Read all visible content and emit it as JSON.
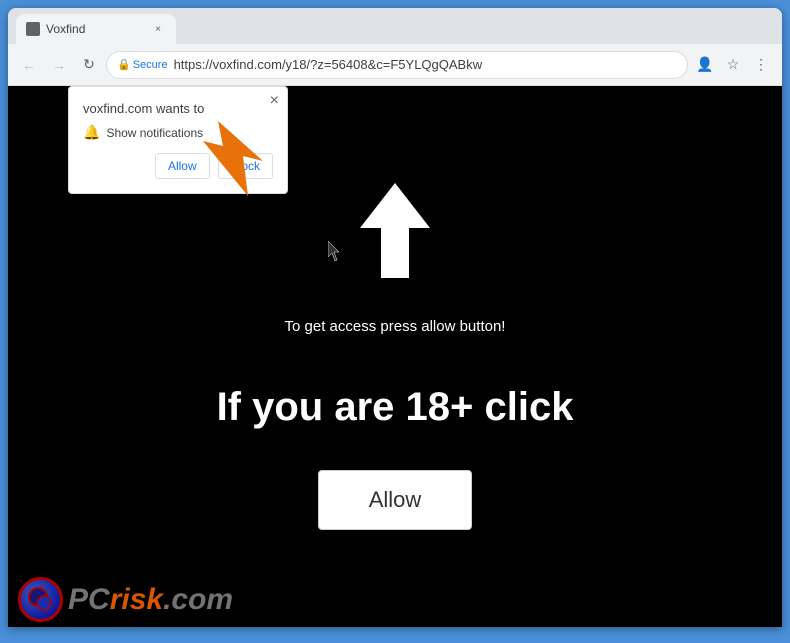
{
  "browser": {
    "tab": {
      "title": "Voxfind",
      "favicon": "V"
    },
    "address": {
      "secure_label": "Secure",
      "url": "https://voxfind.com/y18/?z=56408&c=F5YLQgQABkw"
    },
    "nav": {
      "back": "←",
      "forward": "→",
      "refresh": "↻"
    },
    "toolbar": {
      "bookmark_icon": "☆",
      "menu_icon": "⋮",
      "profile_icon": "👤"
    }
  },
  "notification_popup": {
    "title": "voxfind.com wants to",
    "close_label": "×",
    "notification_item": "Show notifications",
    "allow_btn": "Allow",
    "block_btn": "Block"
  },
  "page": {
    "sub_text": "To get access press allow button!",
    "main_text": "If you are 18+ click",
    "allow_btn": "Allow"
  },
  "watermark": {
    "pc_text": "PC",
    "risk_text": "risk",
    "com_text": ".com"
  },
  "colors": {
    "page_bg": "#000000",
    "orange": "#e8710a",
    "allow_btn_bg": "#ffffff",
    "text_white": "#ffffff"
  }
}
